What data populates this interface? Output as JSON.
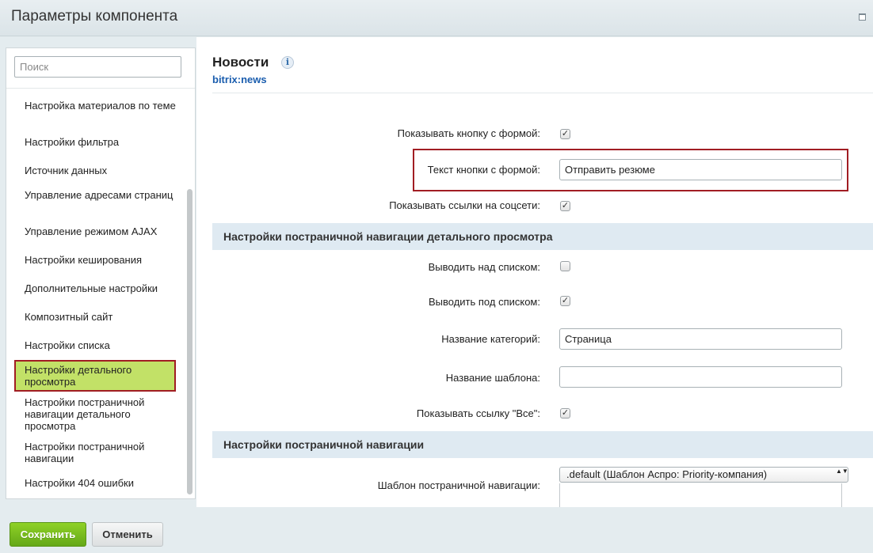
{
  "window": {
    "title": "Параметры компонента"
  },
  "search": {
    "placeholder": "Поиск"
  },
  "sidebar": {
    "items": [
      {
        "label": "Настройка материалов по теме"
      },
      {
        "label": "Настройки фильтра"
      },
      {
        "label": "Источник данных"
      },
      {
        "label": "Управление адресами страниц"
      },
      {
        "label": "Управление режимом AJAX"
      },
      {
        "label": "Настройки кеширования"
      },
      {
        "label": "Дополнительные настройки"
      },
      {
        "label": "Композитный сайт"
      },
      {
        "label": "Настройки списка"
      },
      {
        "label": "Настройки детального просмотра"
      },
      {
        "label": "Настройки постраничной навигации детального просмотра"
      },
      {
        "label": "Настройки постраничной навигации"
      },
      {
        "label": "Настройки 404 ошибки"
      }
    ],
    "active_item": "Настройки детального просмотра"
  },
  "component": {
    "title": "Новости",
    "code": "bitrix:news",
    "info_icon": "i"
  },
  "params": {
    "show_form_button": {
      "label": "Показывать кнопку с формой:",
      "checked": true
    },
    "form_button_text": {
      "label": "Текст кнопки с формой:",
      "value": "Отправить резюме"
    },
    "show_social_links": {
      "label": "Показывать ссылки на соцсети:",
      "checked": true
    }
  },
  "sections": {
    "detail_pager": {
      "title": "Настройки постраничной навигации детального просмотра",
      "show_above": {
        "label": "Выводить над списком:",
        "checked": false
      },
      "show_below": {
        "label": "Выводить под списком:",
        "checked": true
      },
      "category_name": {
        "label": "Название категорий:",
        "value": "Страница"
      },
      "template_name": {
        "label": "Название шаблона:",
        "value": ""
      },
      "show_all_link": {
        "label": "Показывать ссылку \"Все\":",
        "checked": true
      }
    },
    "pager": {
      "title": "Настройки постраничной навигации",
      "template": {
        "label": "Шаблон постраничной навигации:",
        "value": ".default (Шаблон Аспро: Priority-компания)"
      }
    }
  },
  "checkmark": "✓",
  "select_arrows": "▲▼",
  "footer": {
    "save_label": "Сохранить",
    "cancel_label": "Отменить"
  },
  "colors": {
    "save_button": "#76bc1f",
    "active_item_bg": "#c2e167",
    "highlight_border": "#a11d23",
    "section_bg": "#dfeaf2",
    "link_blue": "#1a5dae"
  }
}
